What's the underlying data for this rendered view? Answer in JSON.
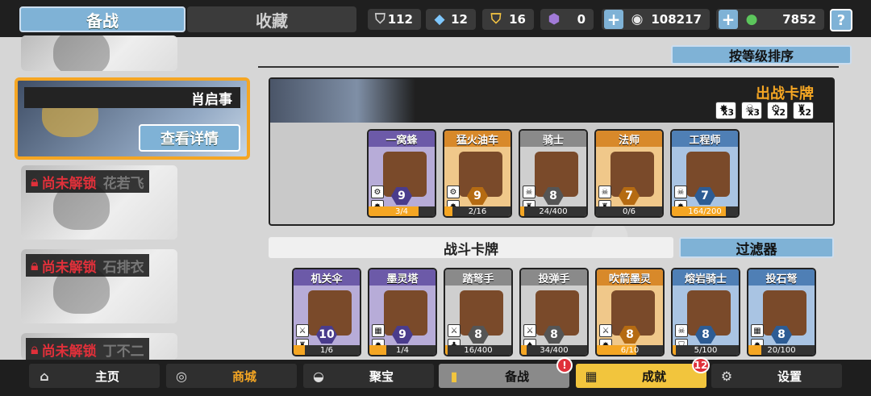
{
  "tabs": {
    "active": "备战",
    "inactive": "收藏"
  },
  "resources": [
    {
      "icon": "silver-shield-icon",
      "glyph": "⛉",
      "value": "112",
      "color": "#cfcfcf"
    },
    {
      "icon": "blue-crystal-icon",
      "glyph": "◆",
      "value": "12",
      "color": "#7fc8ff"
    },
    {
      "icon": "gold-shield-icon",
      "glyph": "⛉",
      "value": "16",
      "color": "#f5c542"
    },
    {
      "icon": "purple-token-icon",
      "glyph": "⬢",
      "value": "0",
      "color": "#a17ad8"
    }
  ],
  "coins": {
    "value": "108217"
  },
  "gems": {
    "value": "7852"
  },
  "help_label": "?",
  "sort_label": "按等级排序",
  "characters": [
    {
      "name": "肖启事",
      "detail_label": "查看详情"
    },
    {
      "lock_label": "尚未解锁",
      "name": "花若飞"
    },
    {
      "lock_label": "尚未解锁",
      "name": "石排衣"
    },
    {
      "lock_label": "尚未解锁",
      "name": "丁不二"
    }
  ],
  "deck": {
    "title": "出战卡牌",
    "modifiers": [
      {
        "icon": "burst-icon",
        "glyph": "✸",
        "count": "x3"
      },
      {
        "icon": "skull-icon",
        "glyph": "☠",
        "count": "x3"
      },
      {
        "icon": "gear-skull-icon",
        "glyph": "⚙",
        "count": "x2"
      },
      {
        "icon": "helmet-icon",
        "glyph": "♜",
        "count": "x2"
      }
    ],
    "cards": [
      {
        "name": "一窝蜂",
        "rarity": "purple",
        "cost": "9",
        "progress": "3/4",
        "fill": 0.75,
        "tag1": "⚙",
        "tag2": "✸"
      },
      {
        "name": "猛火油车",
        "rarity": "orange",
        "cost": "9",
        "progress": "2/16",
        "fill": 0.125,
        "tag1": "⚙",
        "tag2": "✸"
      },
      {
        "name": "骑士",
        "rarity": "gray",
        "cost": "8",
        "progress": "24/400",
        "fill": 0.06,
        "tag1": "☠",
        "tag2": "♜"
      },
      {
        "name": "法师",
        "rarity": "orange",
        "cost": "7",
        "progress": "0/6",
        "fill": 0,
        "tag1": "☠",
        "tag2": "♜"
      },
      {
        "name": "工程师",
        "rarity": "blue",
        "cost": "7",
        "progress": "164/200",
        "fill": 0.82,
        "tag1": "☠",
        "tag2": "✸"
      }
    ]
  },
  "battle_section": {
    "title": "战斗卡牌",
    "filter_label": "过滤器"
  },
  "battle_cards": [
    {
      "name": "机关伞",
      "rarity": "purple",
      "cost": "10",
      "progress": "1/6",
      "fill": 0.17,
      "tag1": "⚔",
      "tag2": "♜"
    },
    {
      "name": "墨灵塔",
      "rarity": "purple",
      "cost": "9",
      "progress": "1/4",
      "fill": 0.25,
      "tag1": "▦",
      "tag2": "✸"
    },
    {
      "name": "踏弩手",
      "rarity": "gray",
      "cost": "8",
      "progress": "16/400",
      "fill": 0.04,
      "tag1": "⚔",
      "tag2": "♣"
    },
    {
      "name": "投弹手",
      "rarity": "gray",
      "cost": "8",
      "progress": "34/400",
      "fill": 0.085,
      "tag1": "⚔",
      "tag2": "♠"
    },
    {
      "name": "吹箭墨灵",
      "rarity": "orange",
      "cost": "8",
      "progress": "6/10",
      "fill": 0.6,
      "tag1": "⚔",
      "tag2": "✸"
    },
    {
      "name": "熔岩骑士",
      "rarity": "blue",
      "cost": "8",
      "progress": "5/100",
      "fill": 0.05,
      "tag1": "☠",
      "tag2": "⛉"
    },
    {
      "name": "投石弩",
      "rarity": "blue",
      "cost": "8",
      "progress": "20/100",
      "fill": 0.2,
      "tag1": "▦",
      "tag2": "✸"
    }
  ],
  "nav": [
    {
      "label": "主页",
      "icon": "home-icon",
      "glyph": "⌂",
      "style": "dark"
    },
    {
      "label": "商城",
      "icon": "coins-icon",
      "glyph": "◎",
      "style": "orange"
    },
    {
      "label": "聚宝",
      "icon": "treasure-bowl-icon",
      "glyph": "◒",
      "style": "dark"
    },
    {
      "label": "备战",
      "icon": "card-deck-icon",
      "glyph": "▮",
      "style": "active",
      "badge": "!"
    },
    {
      "label": "成就",
      "icon": "achievement-grid-icon",
      "glyph": "▦",
      "style": "yellow",
      "badge": "12"
    },
    {
      "label": "设置",
      "icon": "gear-icon",
      "glyph": "⚙",
      "style": "dark"
    }
  ]
}
